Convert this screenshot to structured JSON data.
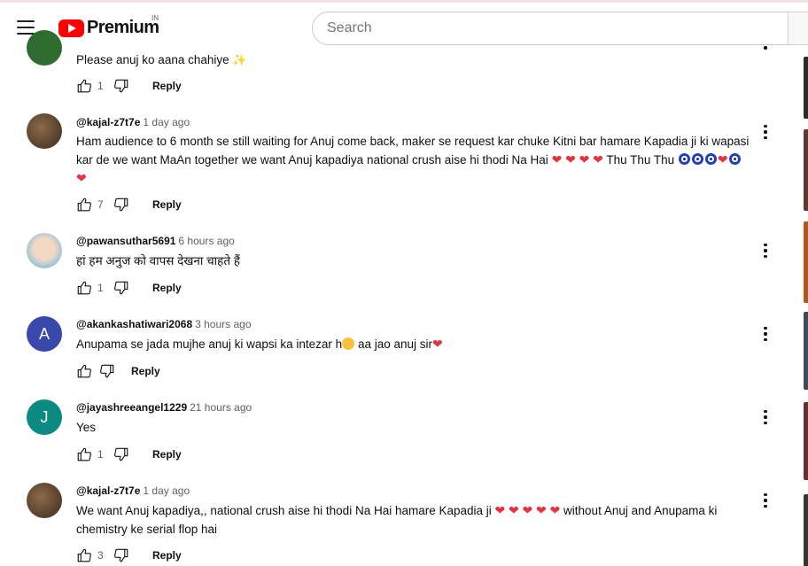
{
  "header": {
    "logo_text": "Premium",
    "country_code": "IN",
    "search_placeholder": "Search"
  },
  "colors": {
    "brand_red": "#ff0000",
    "heart": "#e8323c",
    "avatar_a": "#3949ab",
    "avatar_j": "#0a8a80"
  },
  "comments": [
    {
      "handle": "",
      "time": "",
      "text": "Please anuj ko aana chahiye",
      "emoji_suffix": "✨",
      "likes": "1",
      "reply_label": "Reply"
    },
    {
      "handle": "@kajal-z7t7e",
      "time": "1 day ago",
      "text": "Ham audience to 6 month se still waiting for Anuj come back, maker se request kar chuke Kitni bar hamare Kapadia ji ki wapasi kar de we want MaAn together we want Anuj kapadiya national crush aise hi thodi Na Hai",
      "text_end": "Thu Thu Thu",
      "likes": "7",
      "reply_label": "Reply"
    },
    {
      "handle": "@pawansuthar5691",
      "time": "6 hours ago",
      "text": "हां हम अनुज को वापस देखना चाहते हैं",
      "likes": "1",
      "reply_label": "Reply"
    },
    {
      "handle": "@akankashatiwari2068",
      "time": "3 hours ago",
      "text_part1": "Anupama se jada mujhe anuj ki wapsi ka intezar h",
      "text_part2": "aa jao anuj sir",
      "avatar_letter": "A",
      "likes": "",
      "reply_label": "Reply"
    },
    {
      "handle": "@jayashreeangel1229",
      "time": "21 hours ago",
      "text": "Yes",
      "avatar_letter": "J",
      "likes": "1",
      "reply_label": "Reply"
    },
    {
      "handle": "@kajal-z7t7e",
      "time": "1 day ago",
      "text_part1": "We want Anuj kapadiya,, national crush aise hi thodi Na Hai hamare Kapadia ji",
      "text_part2": "without Anuj and Anupama ki chemistry ke serial flop hai",
      "likes": "3",
      "reply_label": "Reply"
    }
  ],
  "icons": {
    "menu": "hamburger-icon",
    "like": "thumbs-up-icon",
    "dislike": "thumbs-down-icon",
    "more": "more-vert-icon"
  }
}
